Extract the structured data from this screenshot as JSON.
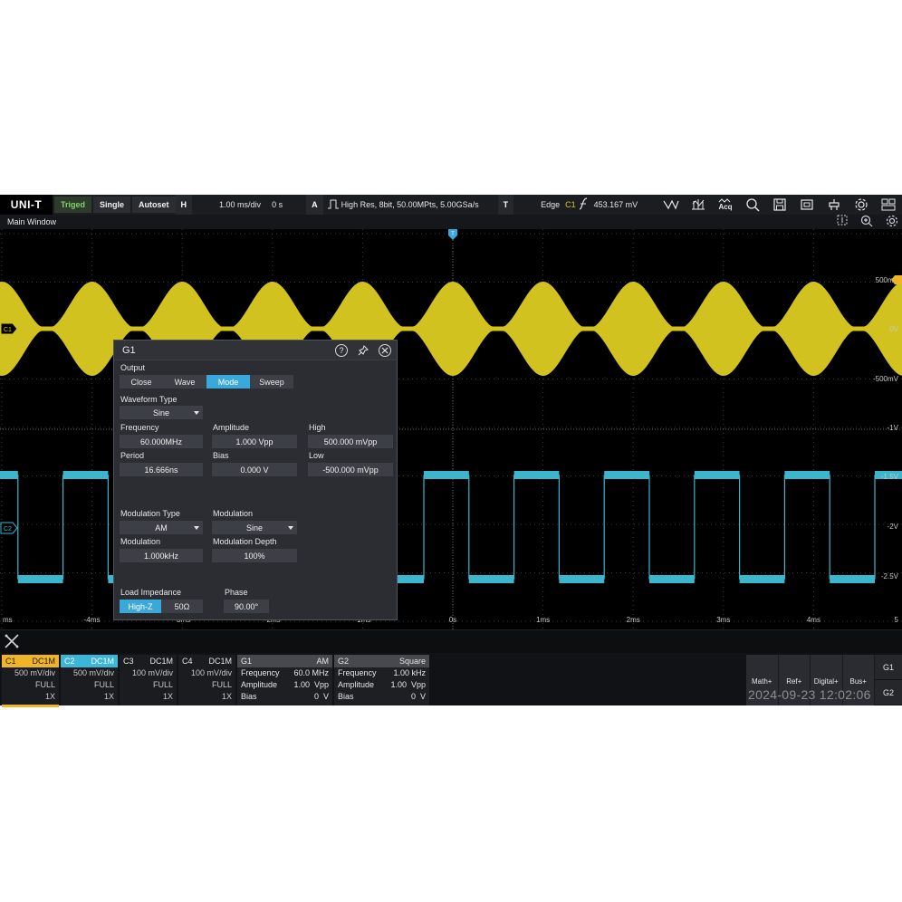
{
  "toolbar": {
    "logo": "UNI-T",
    "status": "Triged",
    "single": "Single",
    "autoset": "Autoset",
    "h_label": "H",
    "timebase": "1.00 ms/div",
    "offset": "0 s",
    "a_label": "A",
    "acq_info": "High Res,  8bit,  50.00MPts,  5.00GSa/s",
    "t_label": "T",
    "trigger_type": "Edge",
    "trigger_source": "C1",
    "trigger_level": "453.167 mV",
    "icons": [
      "wave-icon",
      "measure-icon",
      "acq-icon",
      "search-icon",
      "save-icon",
      "screenshot-icon",
      "utility-icon",
      "settings-icon",
      "display-icon"
    ],
    "acq_text": "Acq"
  },
  "window": {
    "title": "Main Window"
  },
  "plot": {
    "right_labels": [
      "500mV",
      "0V",
      "-500mV",
      "-1V",
      "-1.5V",
      "-2V",
      "-2.5V"
    ],
    "time_labels": [
      "ms",
      "-4ms",
      "-3ms",
      "-2ms",
      "-1ms",
      "0s",
      "1ms",
      "2ms",
      "3ms",
      "4ms",
      "5"
    ],
    "c1_marker": "C1",
    "c2_marker": "C2",
    "trigger_marker": "T",
    "colors": {
      "c1": "#d2c21f",
      "c2": "#3bb6cc",
      "grid": "#3a3a3a"
    }
  },
  "dialog": {
    "title": "G1",
    "output_label": "Output",
    "output_options": [
      "Close",
      "Wave",
      "Mode",
      "Sweep"
    ],
    "output_selected": "Mode",
    "waveform_type_label": "Waveform Type",
    "waveform_type": "Sine",
    "frequency_label": "Frequency",
    "frequency": "60.000MHz",
    "amplitude_label": "Amplitude",
    "amplitude": "1.000 Vpp",
    "high_label": "High",
    "high": "500.000 mVpp",
    "period_label": "Period",
    "period": "16.666ns",
    "bias_label": "Bias",
    "bias": "0.000 V",
    "low_label": "Low",
    "low": "-500.000 mVpp",
    "mod_type_label": "Modulation Type",
    "mod_type": "AM",
    "modulation_label": "Modulation",
    "modulation": "Sine",
    "mod_freq_label": "Modulation",
    "mod_freq": "1.000kHz",
    "mod_depth_label": "Modulation Depth",
    "mod_depth": "100%",
    "load_label": "Load Impedance",
    "load_options": [
      "High-Z",
      "50Ω"
    ],
    "load_selected": "High-Z",
    "phase_label": "Phase",
    "phase": "90.00°"
  },
  "channels": [
    {
      "name": "C1",
      "coupling": "DC1M",
      "scale": "500 mV/div",
      "bw": "FULL",
      "probe": "1X",
      "color": "#f0b429"
    },
    {
      "name": "C2",
      "coupling": "DC1M",
      "scale": "500 mV/div",
      "bw": "FULL",
      "probe": "1X",
      "color": "#3bb6d8"
    },
    {
      "name": "C3",
      "coupling": "DC1M",
      "scale": "100 mV/div",
      "bw": "FULL",
      "probe": "1X"
    },
    {
      "name": "C4",
      "coupling": "DC1M",
      "scale": "100 mV/div",
      "bw": "FULL",
      "probe": "1X"
    }
  ],
  "generators": [
    {
      "name": "G1",
      "type": "AM",
      "freq_label": "Frequency",
      "freq": "60.0 MHz",
      "amp_label": "Amplitude",
      "amp": "1.00",
      "amp_unit": "Vpp",
      "bias_label": "Bias",
      "bias": "0",
      "bias_unit": "V"
    },
    {
      "name": "G2",
      "type": "Square",
      "freq_label": "Frequency",
      "freq": "1.00 kHz",
      "amp_label": "Amplitude",
      "amp": "1.00",
      "amp_unit": "Vpp",
      "bias_label": "Bias",
      "bias": "0",
      "bias_unit": "V"
    }
  ],
  "right_buttons": [
    "Math+",
    "Ref+",
    "Digital+",
    "Bus+"
  ],
  "side_buttons": [
    "G1",
    "G2"
  ],
  "datetime": "2024-09-23 12:02:06"
}
